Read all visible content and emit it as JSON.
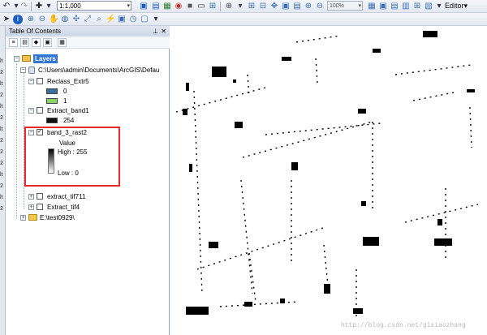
{
  "toolbar": {
    "scale_value": "1:1,000",
    "zoom_value": "100%",
    "editor_label": "Editor▾"
  },
  "toc": {
    "title": "Table Of Contents",
    "layers_label": "Layers",
    "path_label": "C:\\Users\\admin\\Documents\\ArcGIS\\Defau",
    "items": [
      {
        "label": "Reclass_Extr5",
        "checked": false
      },
      {
        "label": "Extract_band1",
        "checked": false
      },
      {
        "label": "band_3_rast2",
        "checked": true
      },
      {
        "label": "extract_tif711",
        "checked": false
      },
      {
        "label": "Extract_tif4",
        "checked": false
      }
    ],
    "reclass_legend": [
      {
        "label": "0",
        "color": "#3e6f9a"
      },
      {
        "label": "1",
        "color": "#8cd06a"
      }
    ],
    "extract_band1_legend": {
      "label": "254",
      "color": "#111111"
    },
    "band3_legend": {
      "value_label": "Value",
      "high_label": "High : 255",
      "low_label": "Low : 0"
    },
    "folder_label": "E:\\test0929\\"
  },
  "left_strip_labels": [
    "lt",
    "2",
    "lt",
    "2",
    "lt",
    "2",
    "lt",
    "2",
    "2",
    "2",
    "lt",
    "2",
    "lt",
    "2"
  ],
  "watermark": "http://blog.csdn.net/gisiaozhang",
  "colors": {
    "highlight": "#e8292b",
    "selection": "#3176d6",
    "toolbar_bg": "#e3e8f0"
  }
}
